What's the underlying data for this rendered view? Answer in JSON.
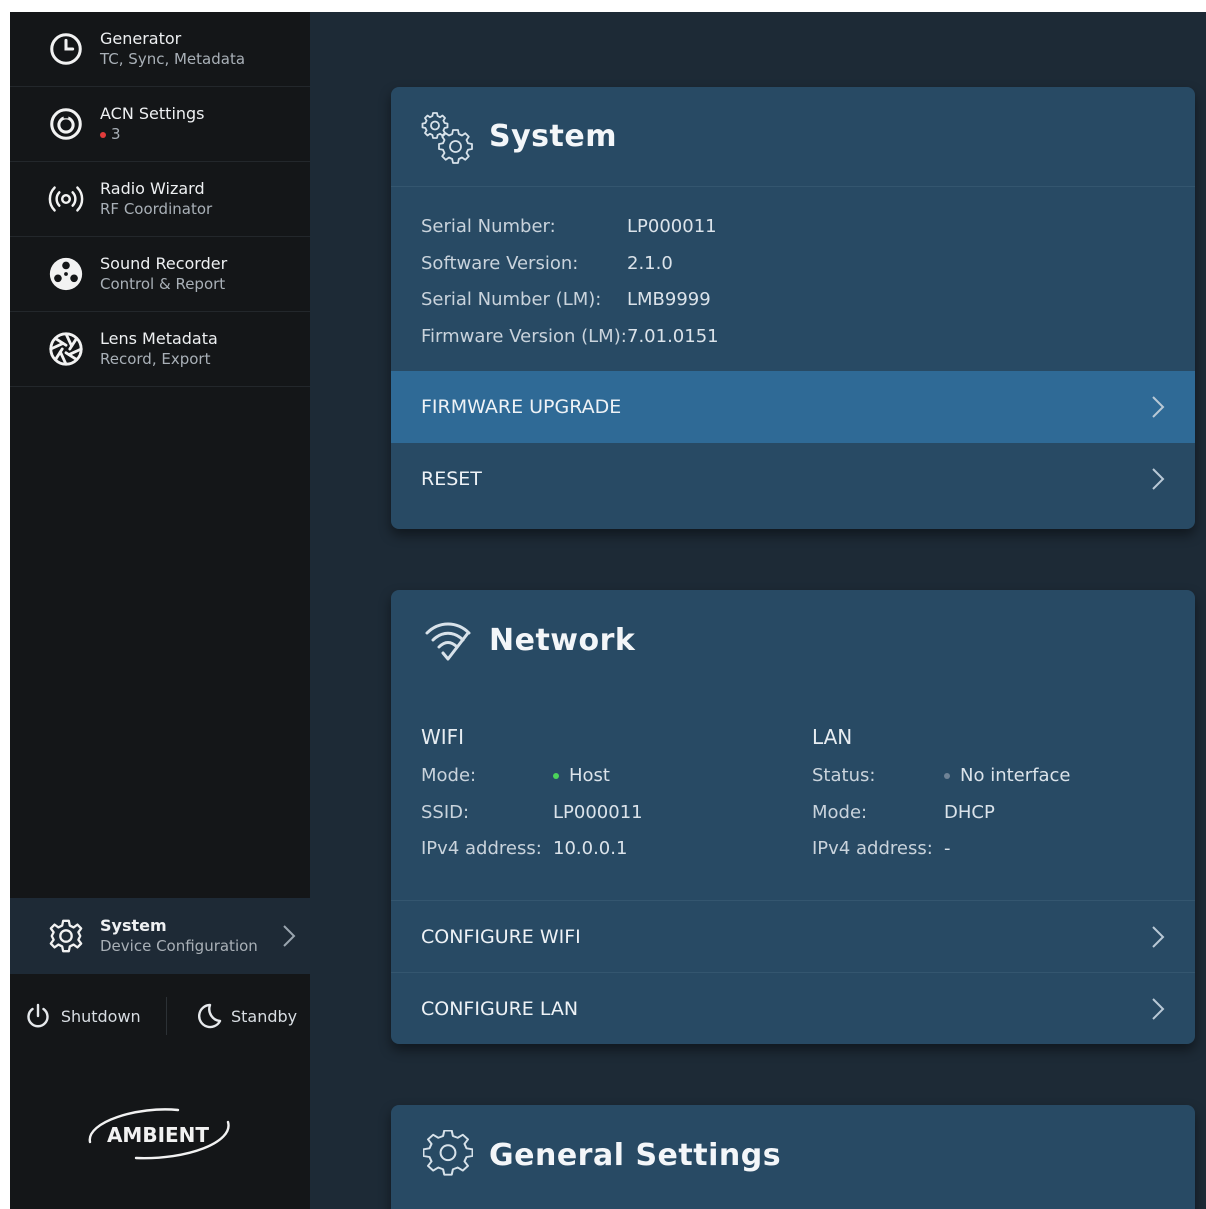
{
  "sidebar": {
    "items": [
      {
        "title": "Generator",
        "subtitle": "TC, Sync, Metadata",
        "icon": "clock-icon"
      },
      {
        "title": "ACN Settings",
        "subtitle": "3",
        "icon": "acn-ring-icon"
      },
      {
        "title": "Radio Wizard",
        "subtitle": "RF Coordinator",
        "icon": "radio-waves-icon"
      },
      {
        "title": "Sound Recorder",
        "subtitle": "Control & Report",
        "icon": "reel-icon"
      },
      {
        "title": "Lens Metadata",
        "subtitle": "Record, Export",
        "icon": "aperture-icon"
      }
    ],
    "active_item": {
      "title": "System",
      "subtitle": "Device Configuration",
      "icon": "gear-icon"
    },
    "shutdown_label": "Shutdown",
    "standby_label": "Standby",
    "logo_text": "AMBIENT"
  },
  "system": {
    "title": "System",
    "rows": [
      {
        "key": "Serial Number:",
        "value": "LP000011"
      },
      {
        "key": "Software Version:",
        "value": "2.1.0"
      },
      {
        "key": "Serial Number (LM):",
        "value": "LMB9999"
      },
      {
        "key": "Firmware Version (LM):",
        "value": "7.01.0151"
      }
    ],
    "firmware_upgrade_label": "FIRMWARE UPGRADE",
    "reset_label": "RESET"
  },
  "network": {
    "title": "Network",
    "wifi": {
      "title": "WIFI",
      "mode_key": "Mode:",
      "mode_value": "Host",
      "ssid_key": "SSID:",
      "ssid_value": "LP000011",
      "ipv4_key": "IPv4 address:",
      "ipv4_value": "10.0.0.1"
    },
    "lan": {
      "title": "LAN",
      "status_key": "Status:",
      "status_value": "No interface",
      "mode_key": "Mode:",
      "mode_value": "DHCP",
      "ipv4_key": "IPv4 address:",
      "ipv4_value": "-"
    },
    "configure_wifi_label": "CONFIGURE WIFI",
    "configure_lan_label": "CONFIGURE LAN"
  },
  "general": {
    "title": "General Settings"
  },
  "colors": {
    "accent": "#2f6a96",
    "card": "#284a64",
    "status_ok": "#4bd35a",
    "status_alert": "#e23b3b"
  }
}
